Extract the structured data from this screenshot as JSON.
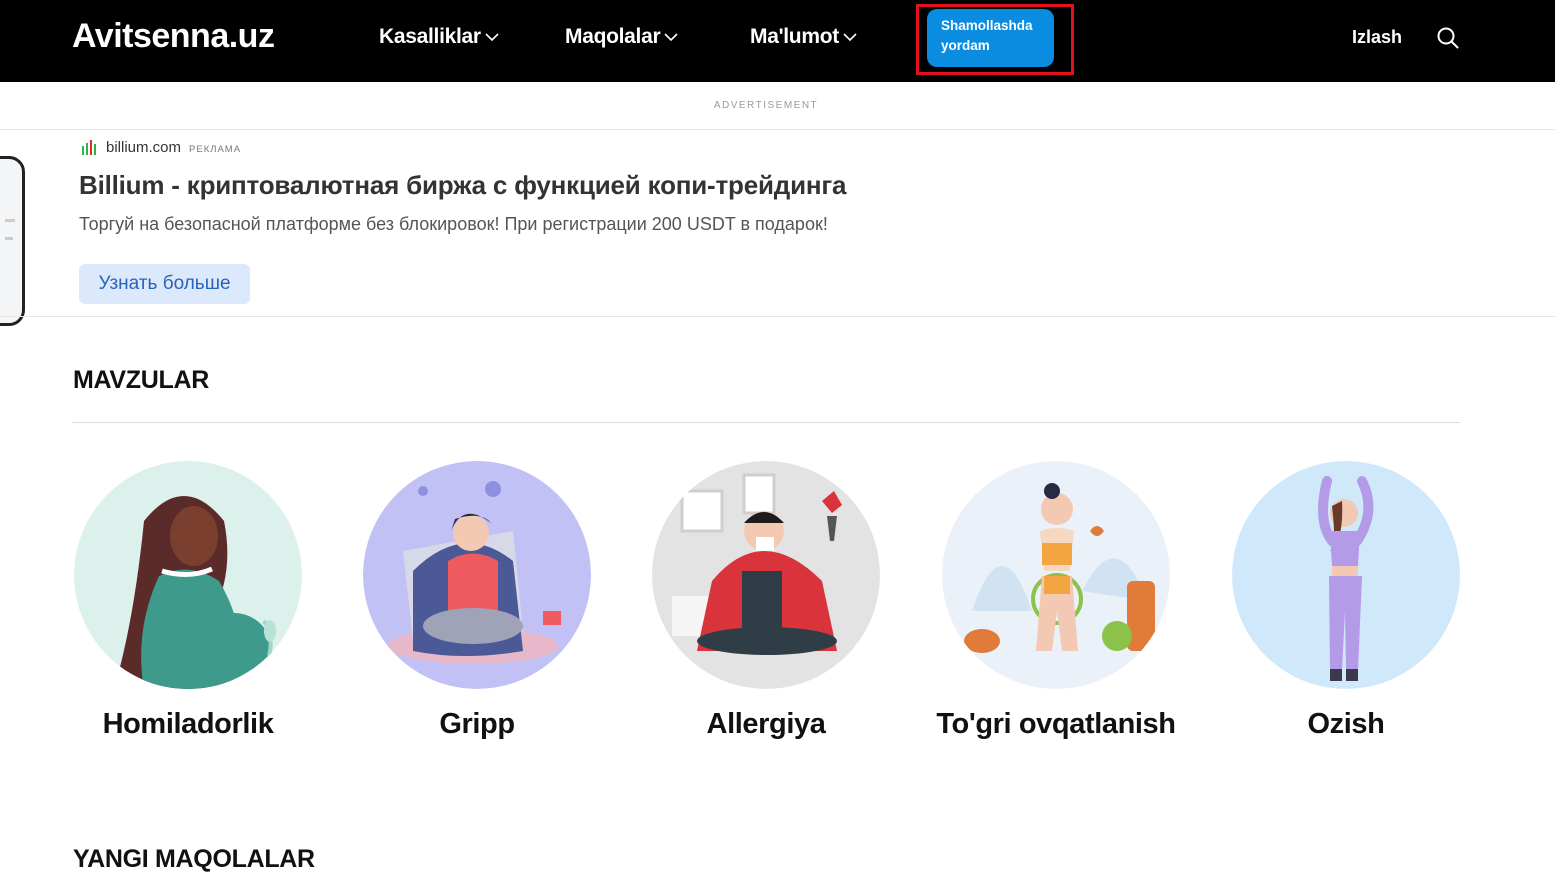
{
  "header": {
    "logo": "Avitsenna.uz",
    "nav": [
      {
        "label": "Kasalliklar"
      },
      {
        "label": "Maqolalar"
      },
      {
        "label": "Ma'lumot"
      }
    ],
    "help_button": {
      "line1": "Shamollashda",
      "line2": "yordam"
    },
    "search_label": "Izlash"
  },
  "ad": {
    "label": "ADVERTISEMENT",
    "brand": "billium.com",
    "brand_tag": "РЕКЛАМА",
    "title": "Billium - криптовалютная биржа с функцией копи-трейдинга",
    "description": "Торгуй на безопасной платформе без блокировок! При регистрации 200 USDT в подарок!",
    "cta": "Узнать больше"
  },
  "topics": {
    "title": "MAVZULAR",
    "items": [
      {
        "label": "Homiladorlik",
        "icon": "pregnant-woman-illustration",
        "bg": "#ddf1ec"
      },
      {
        "label": "Gripp",
        "icon": "sick-woman-blanket-illustration",
        "bg": "#c2c1f5"
      },
      {
        "label": "Allergiya",
        "icon": "sneezing-man-illustration",
        "bg": "#e3e3e3"
      },
      {
        "label": "To'gri ovqatlanish",
        "icon": "healthy-eating-woman-illustration",
        "bg": "#eaf1f8"
      },
      {
        "label": "Ozish",
        "icon": "stretching-woman-illustration",
        "bg": "#cfe9fb"
      }
    ]
  },
  "new_articles": {
    "title": "YANGI MAQOLALAR"
  },
  "colors": {
    "header_bg": "#000000",
    "accent": "#0a8de0",
    "highlight": "#e3111b"
  }
}
